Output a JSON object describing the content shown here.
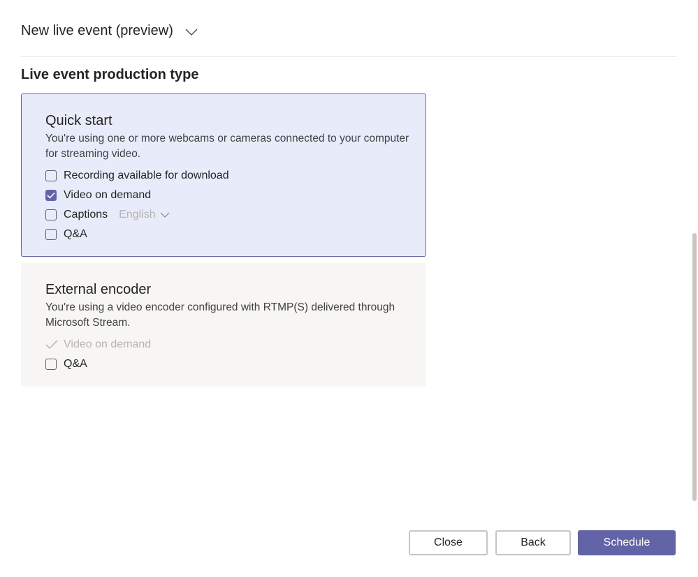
{
  "header": {
    "title": "New live event (preview)",
    "dropdown_icon": "chevron-down-icon"
  },
  "section": {
    "title": "Live event production type"
  },
  "quick_start": {
    "title": "Quick start",
    "description": "You're using one or more webcams or cameras connected to your computer for streaming video.",
    "options": {
      "recording": {
        "label": "Recording available for download",
        "checked": false
      },
      "vod": {
        "label": "Video on demand",
        "checked": true
      },
      "captions": {
        "label": "Captions",
        "checked": false,
        "language": "English"
      },
      "qa": {
        "label": "Q&A",
        "checked": false
      }
    }
  },
  "external_encoder": {
    "title": "External encoder",
    "description": "You're using a video encoder configured with RTMP(S) delivered through Microsoft Stream.",
    "options": {
      "vod": {
        "label": "Video on demand",
        "included": true
      },
      "qa": {
        "label": "Q&A",
        "checked": false
      }
    }
  },
  "footer": {
    "close_label": "Close",
    "back_label": "Back",
    "schedule_label": "Schedule"
  },
  "colors": {
    "accent": "#6264a7",
    "selected_card_bg": "#e8ebfa",
    "card_bg": "#f7f6f5",
    "disabled_text": "#b5b3b1"
  }
}
